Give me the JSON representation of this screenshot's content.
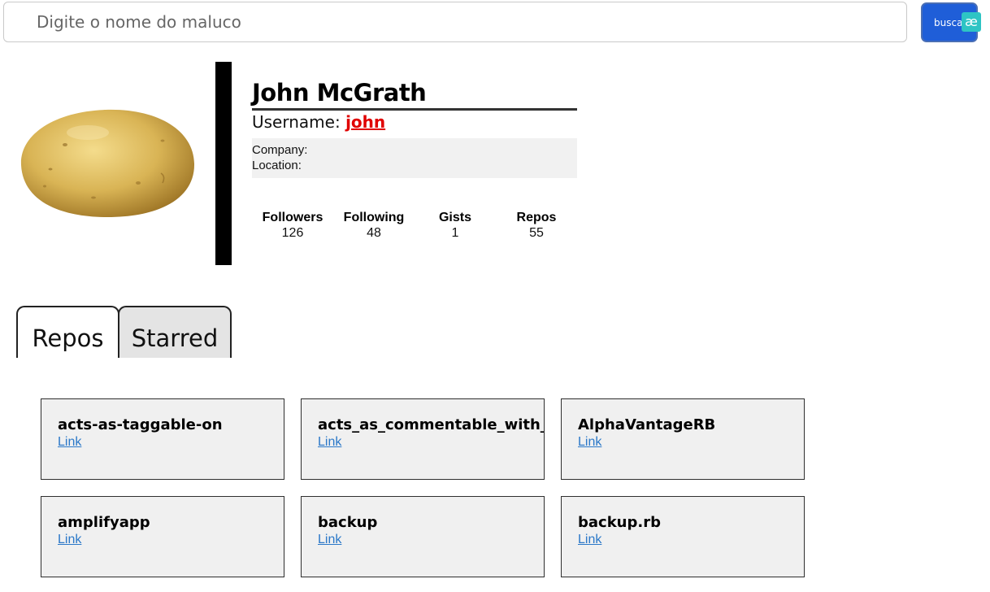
{
  "search": {
    "placeholder": "Digite o nome do maluco",
    "value": ""
  },
  "search_button": {
    "label": "buscar"
  },
  "extension_badge": {
    "label": "æ"
  },
  "profile": {
    "name": "John McGrath",
    "username_label": "Username:",
    "username": "john",
    "company_label": "Company:",
    "company": "",
    "location_label": "Location:",
    "location": "",
    "avatar_icon": "potato-image"
  },
  "stats": [
    {
      "label": "Followers",
      "value": "126"
    },
    {
      "label": "Following",
      "value": "48"
    },
    {
      "label": "Gists",
      "value": "1"
    },
    {
      "label": "Repos",
      "value": "55"
    }
  ],
  "tabs": [
    {
      "label": "Repos",
      "active": true
    },
    {
      "label": "Starred",
      "active": false
    }
  ],
  "repos": [
    {
      "name": "acts-as-taggable-on",
      "link_label": "Link"
    },
    {
      "name": "acts_as_commentable_with_threading",
      "link_label": "Link"
    },
    {
      "name": "AlphaVantageRB",
      "link_label": "Link"
    },
    {
      "name": "amplifyapp",
      "link_label": "Link"
    },
    {
      "name": "backup",
      "link_label": "Link"
    },
    {
      "name": "backup.rb",
      "link_label": "Link"
    }
  ],
  "colors": {
    "accent": "#1f5ed8",
    "username": "#e00000",
    "link": "#2b78c8",
    "card_bg": "#f0f0f0"
  }
}
